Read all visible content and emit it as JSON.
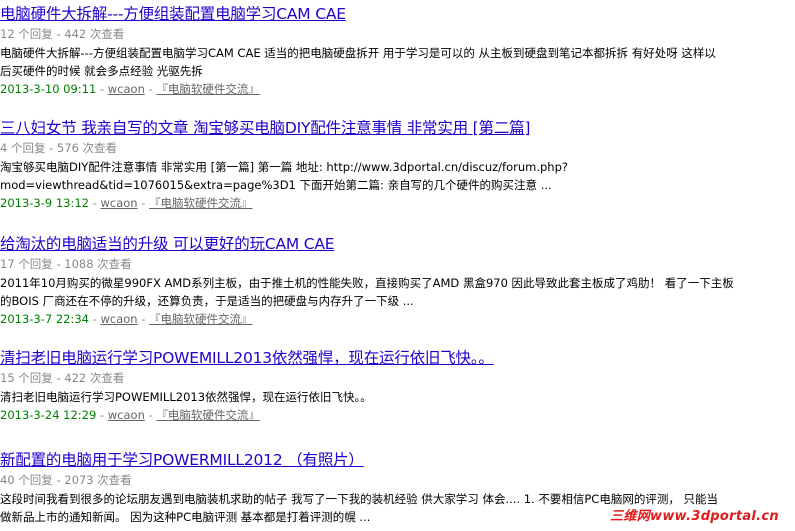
{
  "results": [
    {
      "title": "电脑硬件大拆解---方便组装配置电脑学习CAM CAE",
      "stats": "12 个回复 - 442 次查看",
      "snippet": [
        "电脑硬件大拆解---方便组装配置电脑学习CAM CAE 适当的把电脑硬盘拆开 用于学习是可以的 从主板到硬盘到笔记本都拆拆 有好处呀 这样以",
        "后买硬件的时候 就会多点经验 光驱先拆"
      ],
      "date": "2013-3-10 09:11",
      "author": "wcaon",
      "forum": "『电脑软硬件交流』"
    },
    {
      "title": "三八妇女节 我亲自写的文章 淘宝够买电脑DIY配件注意事情 非常实用 [第二篇]",
      "stats": "4 个回复 - 576 次查看",
      "snippet": [
        "淘宝够买电脑DIY配件注意事情 非常实用 [第一篇] 第一篇 地址:  http://www.3dportal.cn/discuz/forum.php?",
        "mod=viewthread&tid=1076015&extra=page%3D1 下面开始第二篇: 亲自写的几个硬件的购买注意 ..."
      ],
      "date": "2013-3-9 13:12",
      "author": "wcaon",
      "forum": "『电脑软硬件交流』"
    },
    {
      "title": "给淘汰的电脑适当的升级 可以更好的玩CAM CAE",
      "stats": "17 个回复 - 1088 次查看",
      "snippet": [
        "2011年10月购买的微星990FX AMD系列主板，由于推土机的性能失败，直接购买了AMD 黑盒970 因此导致此套主板成了鸡肋！ 看了一下主板",
        "的BOIS 厂商还在不停的升级，还算负责，于是适当的把硬盘与内存升了一下级 ..."
      ],
      "date": "2013-3-7 22:34",
      "author": "wcaon",
      "forum": "『电脑软硬件交流』"
    },
    {
      "title": "清扫老旧电脑运行学习POWEMILL2013依然强悍，现在运行依旧飞快。。",
      "stats": "15 个回复 - 422 次查看",
      "snippet": [
        "清扫老旧电脑运行学习POWEMILL2013依然强悍，现在运行依旧飞快。。"
      ],
      "date": "2013-3-24 12:29",
      "author": "wcaon",
      "forum": "『电脑软硬件交流』"
    },
    {
      "title": "新配置的电脑用于学习POWERMILL2012 （有照片）",
      "stats": "40 个回复 - 2073 次查看",
      "snippet": [
        "这段时间我看到很多的论坛朋友遇到电脑装机求助的帖子 我写了一下我的装机经验 供大家学习 体会.... 1. 不要相信PC电脑网的评测， 只能当",
        "做新品上市的通知新闻。 因为这种PC电脑评测 基本都是打着评测的幌 ..."
      ],
      "date": "",
      "author": "",
      "forum": ""
    }
  ],
  "meta_separator": " - ",
  "watermark": "三维网www.3dportal.cn",
  "colors": {
    "title_link": "#2200cc",
    "stats": "#888888",
    "date": "#008000",
    "watermark": "#e11b1b"
  }
}
